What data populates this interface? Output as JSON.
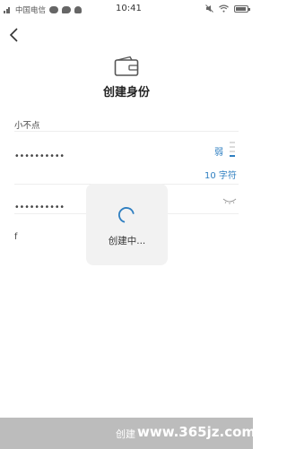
{
  "status_bar": {
    "carrier": "中国电信",
    "time": "10:41",
    "icons": [
      "sim-signal-icon",
      "wechat-icon",
      "message-icon",
      "qq-icon",
      "mute-icon",
      "wifi-icon",
      "battery-icon"
    ]
  },
  "header": {
    "back_icon": "chevron-left-icon",
    "wallet_icon": "wallet-icon",
    "title": "创建身份"
  },
  "form": {
    "identity_name": "小不点",
    "password": "••••••••••",
    "password_strength": "弱",
    "password_length": "10 字符",
    "repeat_password": "••••••••••",
    "password_hint": "f"
  },
  "loading": {
    "text": "创建中..."
  },
  "footer": {
    "create_label": "创建",
    "watermark": "www.365jz.com"
  },
  "colors": {
    "accent": "#2f7fc1",
    "button_disabled": "#bcbcbc",
    "overlay_bg": "#f2f2f2"
  }
}
